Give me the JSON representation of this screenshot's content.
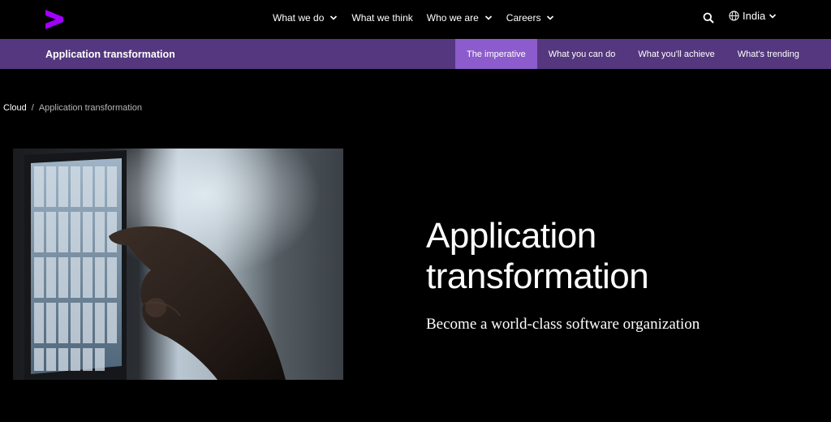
{
  "header": {
    "menu": [
      {
        "label": "What we do",
        "has_dropdown": true
      },
      {
        "label": "What we think",
        "has_dropdown": false
      },
      {
        "label": "Who we are",
        "has_dropdown": true
      },
      {
        "label": "Careers",
        "has_dropdown": true
      }
    ],
    "locale": "India",
    "brand_color": "#a100ff"
  },
  "subnav": {
    "title": "Application transformation",
    "tabs": [
      {
        "label": "The imperative",
        "active": true
      },
      {
        "label": "What you can do",
        "active": false
      },
      {
        "label": "What you'll achieve",
        "active": false
      },
      {
        "label": "What's trending",
        "active": false
      }
    ],
    "bg_color": "#54377e",
    "active_color": "#8c5bcc"
  },
  "breadcrumb": {
    "parent": "Cloud",
    "separator": "/",
    "current": "Application transformation"
  },
  "hero": {
    "title_line1": "Application",
    "title_line2": "transformation",
    "subtitle": "Become a world-class software organization"
  }
}
